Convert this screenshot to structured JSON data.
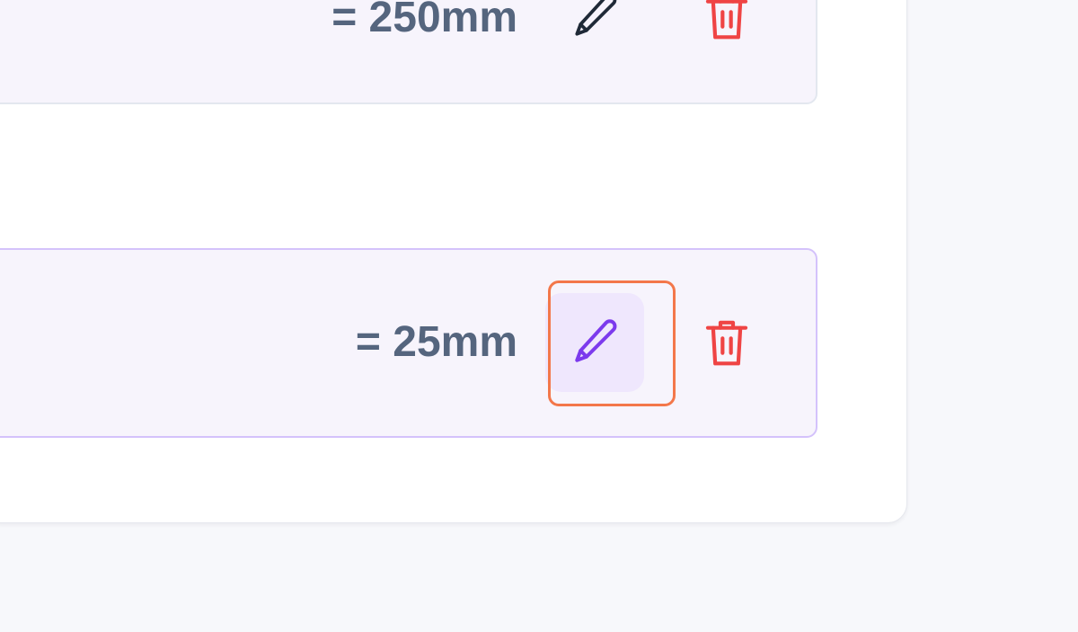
{
  "rows": [
    {
      "value": "= 250mm",
      "edit_icon": "pencil-icon",
      "delete_icon": "trash-icon",
      "edit_color": "#1f2937",
      "delete_color": "#ef4444"
    },
    {
      "value": "= 25mm",
      "edit_icon": "pencil-icon",
      "delete_icon": "trash-icon",
      "edit_color": "#7c3aed",
      "delete_color": "#ef4444",
      "edit_state": "focused"
    }
  ],
  "colors": {
    "page_background": "#f7f8fb",
    "card_background": "#ffffff",
    "row_background": "#f7f4fc",
    "active_row_border": "#d4c2fb",
    "focus_ring": "#f3774a",
    "value_text": "#55657e"
  }
}
